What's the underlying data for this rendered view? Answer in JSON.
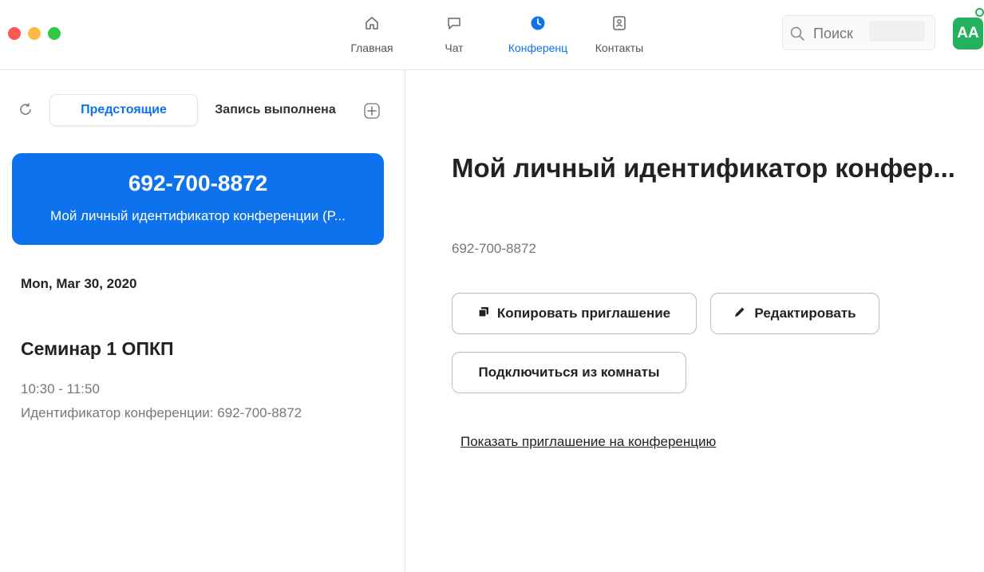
{
  "window": {
    "traffic_lights": [
      "close",
      "minimize",
      "zoom"
    ],
    "colors": {
      "close": "#fc5753",
      "minimize": "#fdbc40",
      "zoom": "#33c748"
    }
  },
  "nav": {
    "tabs": [
      {
        "label": "Главная",
        "icon": "home-icon"
      },
      {
        "label": "Чат",
        "icon": "chat-bubble-icon"
      },
      {
        "label": "Конференц",
        "icon": "clock-icon",
        "active": true
      },
      {
        "label": "Контакты",
        "icon": "contacts-icon"
      }
    ],
    "accent": "#0e72ed"
  },
  "search": {
    "placeholder": "Поиск",
    "icon": "search-icon"
  },
  "avatar": {
    "initials": "AA",
    "color": "#23b15f"
  },
  "left": {
    "segments": {
      "upcoming": "Предстоящие",
      "recorded": "Запись выполнена"
    },
    "pmi_card": {
      "meeting_id": "692-700-8872",
      "name": "Мой личный идентификатор конференции (P..."
    },
    "date_header": "Mon, Mar 30, 2020",
    "meeting": {
      "title": "Семинар 1 ОПКП",
      "time": "10:30 - 11:50",
      "id_line": "Идентификатор конференции: 692-700-8872"
    }
  },
  "detail": {
    "title": "Мой личный идентификатор конфер...",
    "meeting_id": "692-700-8872",
    "buttons": {
      "copy": "Копировать приглашение",
      "edit": "Редактировать",
      "join_room": "Подключиться из комнаты"
    },
    "show_invite_link": "Показать приглашение на конференцию"
  }
}
